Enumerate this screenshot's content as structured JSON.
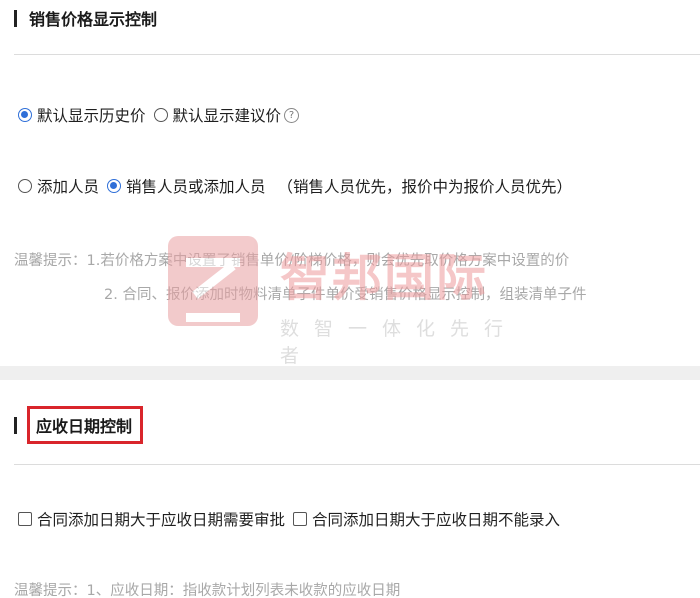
{
  "section1": {
    "title": "销售价格显示控制",
    "price_default": {
      "options": [
        {
          "label": "默认显示历史价",
          "selected": true
        },
        {
          "label": "默认显示建议价",
          "selected": false
        }
      ],
      "help_icon": "question-circle-icon"
    },
    "add_person": {
      "options": [
        {
          "label": "添加人员",
          "selected": false
        },
        {
          "label": "销售人员或添加人员",
          "selected": true
        }
      ],
      "note": "（销售人员优先，报价中为报价人员优先）"
    },
    "hint_line1": "温馨提示：1.若价格方案中设置了销售单价/阶梯价格，则会优先取价格方案中设置的价",
    "hint_line2": "2. 合同、报价添加时物料清单子件单价受销售价格显示控制，组装清单子件"
  },
  "section2": {
    "title": "应收日期控制",
    "checkboxes": [
      {
        "label": "合同添加日期大于应收日期需要审批",
        "checked": false
      },
      {
        "label": "合同添加日期大于应收日期不能录入",
        "checked": false
      }
    ],
    "hint_line1": "温馨提示：1、应收日期：指收款计划列表未收款的应收日期"
  },
  "watermark": {
    "name": "智邦国际",
    "slogan": "数智一体化先行者",
    "logo_icon": "zhibang-logo-icon"
  },
  "colors": {
    "accent": "#2f6fd8",
    "highlight_border": "#d9252b",
    "hint_text": "#a8a8a8",
    "watermark": "#ee9a9c"
  }
}
